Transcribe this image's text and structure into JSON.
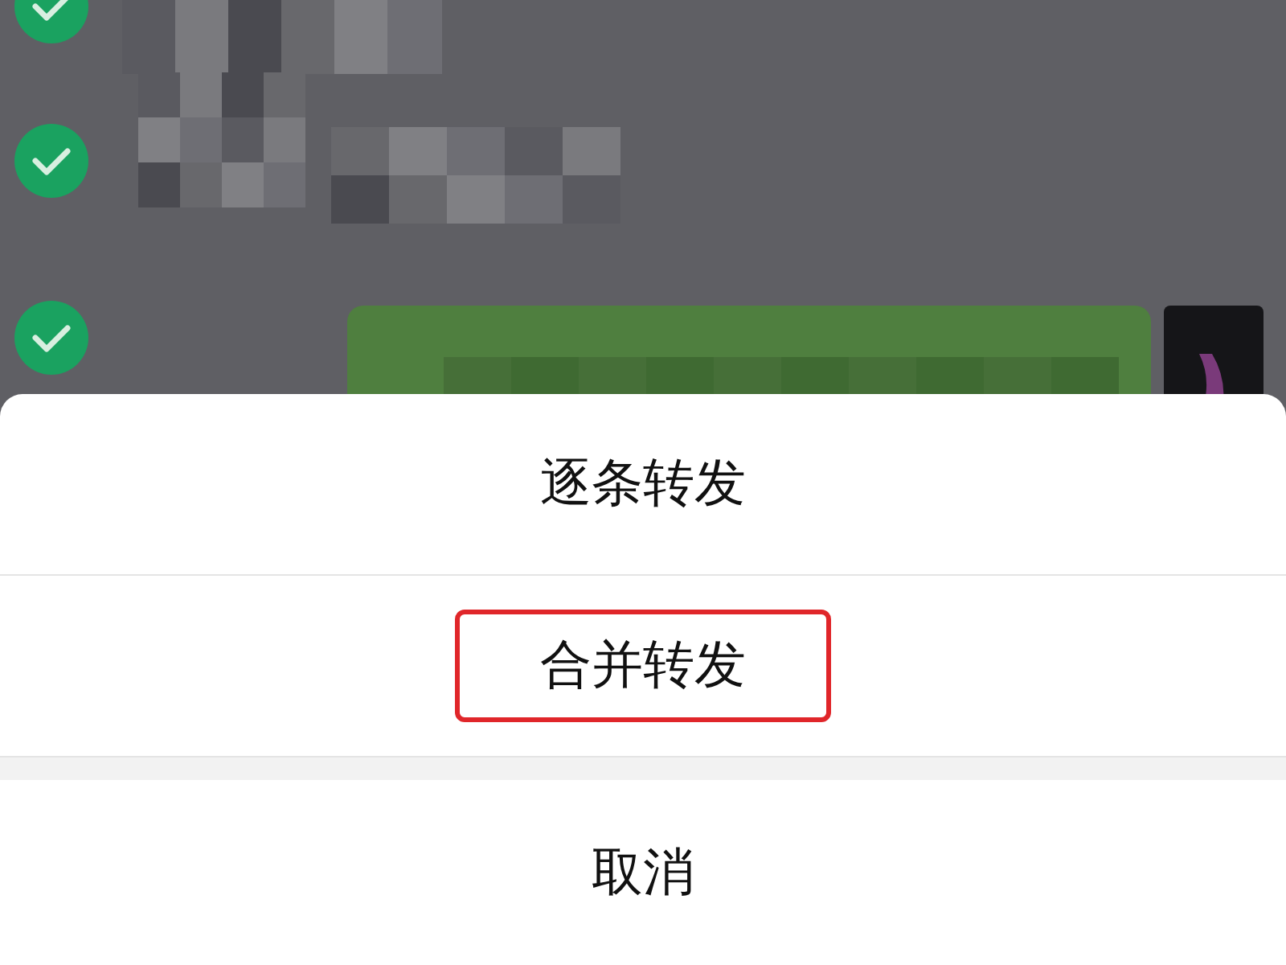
{
  "messages": [
    {
      "kind": "received",
      "checked": true
    },
    {
      "kind": "received",
      "checked": true
    },
    {
      "kind": "sent",
      "checked": true
    }
  ],
  "sheet": {
    "options": [
      {
        "label": "逐条转发",
        "highlighted": false
      },
      {
        "label": "合并转发",
        "highlighted": true
      }
    ],
    "cancel": "取消"
  }
}
